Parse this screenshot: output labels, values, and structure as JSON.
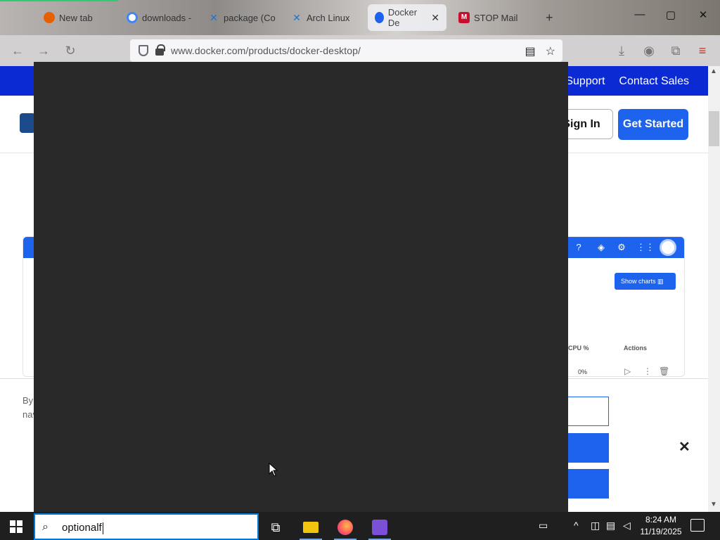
{
  "browser": {
    "tabs": [
      {
        "label": "New tab",
        "icon": "firefox-icon",
        "active": false
      },
      {
        "label": "downloads -",
        "icon": "google-icon",
        "active": false
      },
      {
        "label": "package (Co",
        "icon": "x-icon",
        "active": false
      },
      {
        "label": "Arch Linux",
        "icon": "x-icon",
        "active": false
      },
      {
        "label": "Docker De",
        "icon": "docker-icon",
        "active": true
      },
      {
        "label": "STOP Mail",
        "icon": "m-icon",
        "active": false
      }
    ],
    "new_tab_label": "+",
    "window_controls": {
      "minimize": "—",
      "maximize": "▢",
      "close": "✕"
    },
    "address": "www.docker.com/products/docker-desktop/"
  },
  "page": {
    "nav_links": [
      "Support",
      "Contact Sales"
    ],
    "sign_in": "Sign In",
    "get_started": "Get Started",
    "app_preview": {
      "show_charts": "Show charts",
      "columns": [
        "CPU %",
        "Actions"
      ],
      "row": {
        "cpu": "0%"
      }
    },
    "cookie": {
      "by": "By",
      "nav": "nav"
    }
  },
  "taskbar": {
    "search_value": "optionalf",
    "clock_time": "8:24 AM",
    "clock_date": "11/19/2025"
  }
}
